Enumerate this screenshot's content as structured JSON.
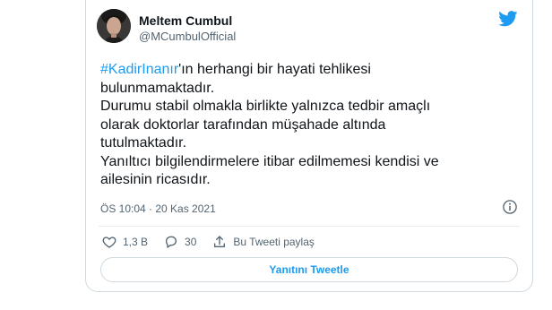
{
  "author": {
    "name": "Meltem Cumbul",
    "handle": "@MCumbulOfficial"
  },
  "tweet": {
    "hashtag": "#KadirInanır",
    "line1_rest": "'ın herhangi bir hayati tehlikesi",
    "lines": [
      "bulunmamaktadır.",
      "Durumu stabil olmakla birlikte yalnızca  tedbir amaçlı",
      "olarak doktorlar tarafından müşahade altında",
      "tutulmaktadır.",
      "Yanıltıcı bilgilendirmelere itibar edilmemesi kendisi ve",
      "ailesinin ricasıdır."
    ],
    "timestamp": "ÖS 10:04 · 20 Kas 2021"
  },
  "actions": {
    "likes": "1,3 B",
    "replies": "30",
    "share_label": "Bu Tweeti paylaş"
  },
  "reply_button": {
    "label": "Yanıtını Tweetle"
  },
  "colors": {
    "accent": "#1d9bf0",
    "muted": "#536471",
    "border": "#cfd9de"
  },
  "icons": [
    "avatar-photo",
    "twitter-bird-icon",
    "info-icon",
    "heart-icon",
    "reply-bubble-icon",
    "share-icon"
  ]
}
